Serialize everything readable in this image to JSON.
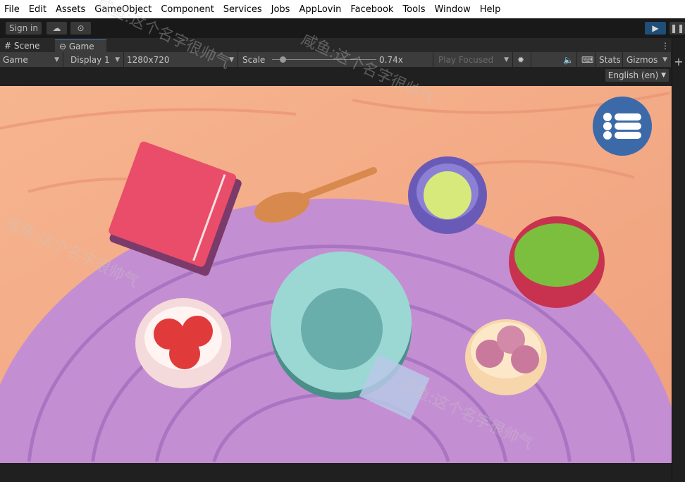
{
  "menu": [
    "File",
    "Edit",
    "Assets",
    "GameObject",
    "Component",
    "Services",
    "Jobs",
    "AppLovin",
    "Facebook",
    "Tools",
    "Window",
    "Help"
  ],
  "toolbar": {
    "sign_in": "Sign in"
  },
  "tabs": [
    {
      "label": "Scene",
      "icon": "hash-icon"
    },
    {
      "label": "Game",
      "icon": "gamepad-icon"
    }
  ],
  "gamebar": {
    "view": "Game",
    "display": "Display 1",
    "resolution": "1280x720",
    "scale_label": "Scale",
    "scale_value": "0.74x",
    "scale_fraction": 0.1,
    "play_mode": "Play Focused",
    "stats": "Stats",
    "gizmos": "Gizmos"
  },
  "language": "English (en)",
  "watermark": "咸鱼:这个名字很帅气",
  "colors": {
    "play_active": "#1f4e79",
    "menu_button": "#3c6aa8"
  }
}
